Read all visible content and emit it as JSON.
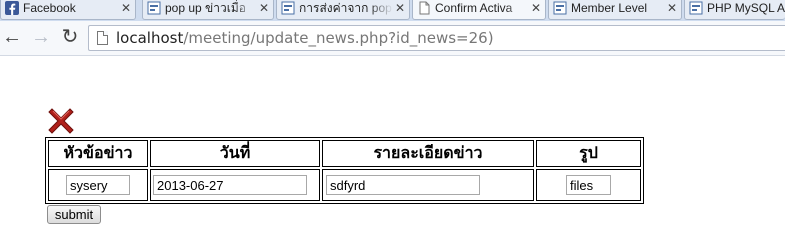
{
  "browser": {
    "tabs": [
      {
        "label": "Facebook",
        "icon": "facebook-icon",
        "active": false
      },
      {
        "label": "pop up ข่าวเมื่อ",
        "icon": "webboard-icon",
        "active": false
      },
      {
        "label": "การส่งค่าจาก pop",
        "icon": "webboard-icon",
        "active": false
      },
      {
        "label": "Confirm Activa",
        "icon": "page-icon",
        "active": true
      },
      {
        "label": "Member Level",
        "icon": "webboard-icon",
        "active": false
      },
      {
        "label": "PHP MySQL Ac",
        "icon": "webboard-icon",
        "active": false
      }
    ],
    "tab_close": "✕",
    "back_glyph": "←",
    "forward_glyph": "→",
    "reload_glyph": "↻",
    "url_host": "localhost",
    "url_path": "/meeting/update_news.php?id_news=26)"
  },
  "form": {
    "headers": [
      "หัวข้อข่าว",
      "วันที่",
      "รายละเอียดข่าว",
      "รูป"
    ],
    "fields": [
      {
        "name": "topic",
        "value": "sysery"
      },
      {
        "name": "date",
        "value": "2013-06-27"
      },
      {
        "name": "detail",
        "value": "sdfyrd"
      },
      {
        "name": "image",
        "value": "files"
      }
    ],
    "submit_label": "submit"
  },
  "colors": {
    "tabstrip": "#cfdcef",
    "delete_icon": "#b0201a",
    "facebook": "#3b5998"
  }
}
